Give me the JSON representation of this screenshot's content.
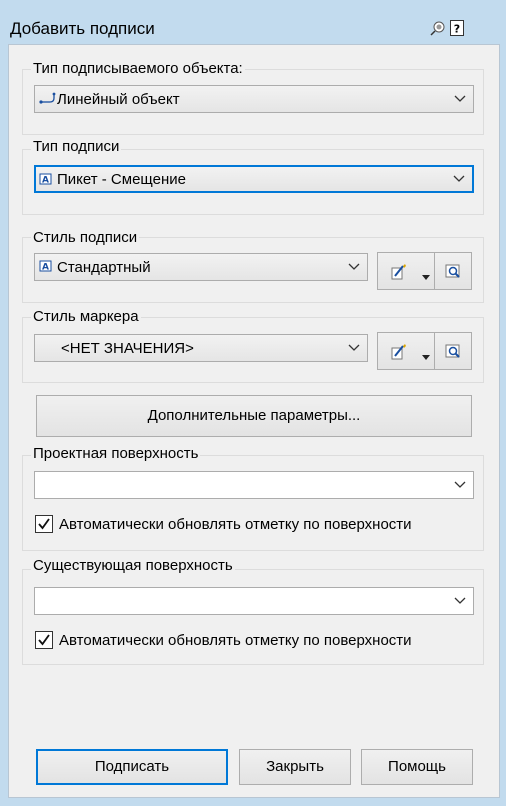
{
  "window": {
    "title": "Добавить подписи"
  },
  "object_type": {
    "label": "Тип подписываемого объекта:",
    "value": "Линейный объект"
  },
  "label_type": {
    "label": "Тип подписи",
    "value": "Пикет - Смещение"
  },
  "label_style": {
    "label": "Стиль подписи",
    "value": "Стандартный"
  },
  "marker_style": {
    "label": "Стиль маркера",
    "value": "<НЕТ ЗНАЧЕНИЯ>"
  },
  "more_options_button": "Дополнительные параметры...",
  "design_surface": {
    "label": "Проектная поверхность",
    "value": "",
    "checkbox_label": "Автоматически обновлять отметку по поверхности",
    "checked": true
  },
  "existing_surface": {
    "label": "Существующая поверхность",
    "value": "",
    "checkbox_label": "Автоматически обновлять отметку по поверхности",
    "checked": true
  },
  "buttons": {
    "add": "Подписать",
    "close": "Закрыть",
    "help": "Помощь"
  },
  "icons": [
    "pin-icon",
    "help-icon",
    "alignment-icon",
    "label-style-icon",
    "edit-style-icon",
    "dropdown-arrow-icon",
    "preview-icon",
    "chevron-down-icon",
    "checkmark-icon"
  ],
  "colors": {
    "window_frame": "#c2dbee",
    "panel": "#f0f0f0",
    "focus_border": "#0078d7"
  }
}
